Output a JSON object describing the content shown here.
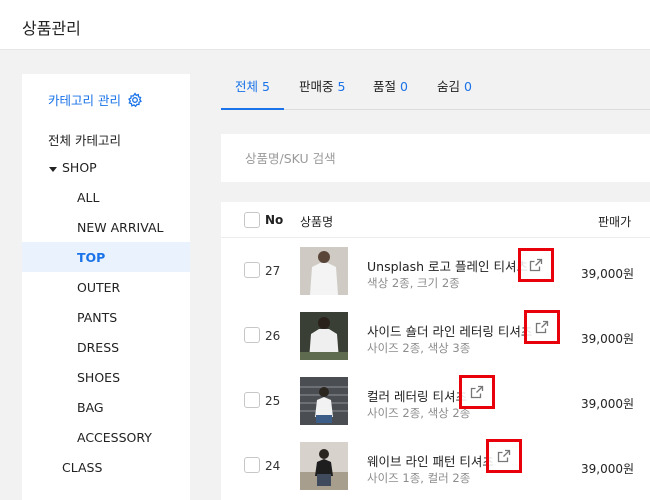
{
  "app": {
    "title": "상품관리"
  },
  "sidebar": {
    "manage_label": "카테고리 관리",
    "all_categories": "전체 카테고리",
    "shop": "SHOP",
    "items": [
      "ALL",
      "NEW ARRIVAL",
      "TOP",
      "OUTER",
      "PANTS",
      "DRESS",
      "SHOES",
      "BAG",
      "ACCESSORY"
    ],
    "active_item": "TOP",
    "class": "CLASS"
  },
  "tabs": [
    {
      "label": "전체",
      "count": "5"
    },
    {
      "label": "판매중",
      "count": "5"
    },
    {
      "label": "품절",
      "count": "0"
    },
    {
      "label": "숨김",
      "count": "0"
    }
  ],
  "search": {
    "placeholder": "상품명/SKU 검색",
    "value": ""
  },
  "table": {
    "headers": {
      "no": "No",
      "name": "상품명",
      "price": "판매가"
    },
    "rows": [
      {
        "no": "27",
        "name": "Unsplash 로고 플레인 티셔츠",
        "meta": "색상 2종, 크기 2종",
        "price": "39,000원"
      },
      {
        "no": "26",
        "name": "사이드 숄더 라인 레터링 티셔츠",
        "meta": "사이즈 2종, 색상 3종",
        "price": "39,000원"
      },
      {
        "no": "25",
        "name": "컬러 레터링 티셔츠",
        "meta": "사이즈 2종, 색상 2종",
        "price": "39,000원"
      },
      {
        "no": "24",
        "name": "웨이브 라인 패턴 티셔츠",
        "meta": "사이즈 1종, 컬러 2종",
        "price": "39,000원"
      }
    ]
  },
  "colors": {
    "accent": "#1a73e8",
    "highlight": "#e8000b",
    "background": "#f2f2f3"
  },
  "icons": {
    "settings": "gear-icon",
    "external": "external-link-icon",
    "expand": "caret-down-icon"
  }
}
